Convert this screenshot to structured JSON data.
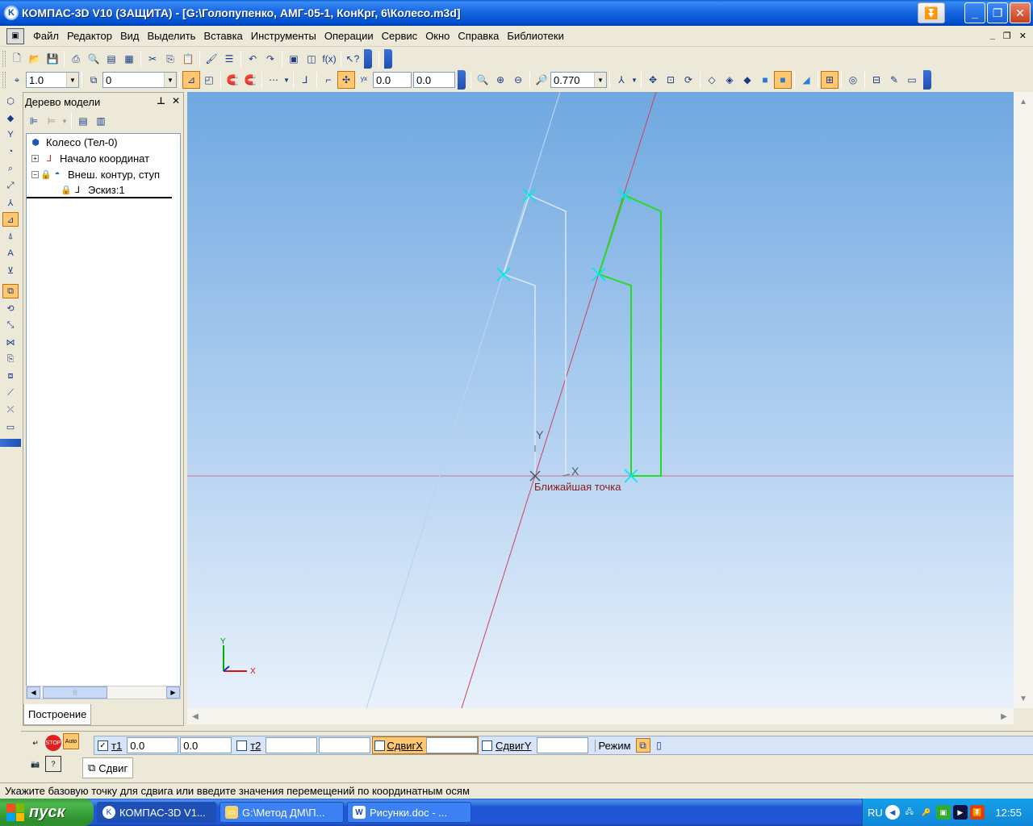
{
  "window": {
    "title": "КОМПАС-3D V10 (ЗАЩИТА) - [G:\\Голопупенко, АМГ-05-1, КонКрг, 6\\Колесо.m3d]",
    "minimize": "_",
    "maximize": "❐",
    "close": "✕"
  },
  "menu": {
    "items": [
      "Файл",
      "Редактор",
      "Вид",
      "Выделить",
      "Вставка",
      "Инструменты",
      "Операции",
      "Сервис",
      "Окно",
      "Справка",
      "Библиотеки"
    ]
  },
  "toolbar2": {
    "step_value": "1.0",
    "layer_value": "0",
    "x_value": "0.0",
    "y_value": "0.0",
    "zoom_value": "0.770"
  },
  "tree": {
    "header": "Дерево модели",
    "root": "Колесо (Тел-0)",
    "items": [
      "Начало координат",
      "Внеш. контур, ступ",
      "Эскиз:1"
    ],
    "tab": "Построение"
  },
  "canvas": {
    "axis_y_label": "Y",
    "axis_x_label": "X",
    "snap_tooltip": "Ближайшая точка",
    "corner_y": "Y",
    "corner_x": "X",
    "colors": {
      "active_contour": "#22dd22",
      "ghost_contour": "#c8d8ee",
      "red_axis": "#d04060",
      "blue_axis": "#a9c8ec",
      "cross_marker": "#00e0e0"
    }
  },
  "propbar": {
    "t1_label": "т1",
    "t1_x": "0.0",
    "t1_y": "0.0",
    "t2_label": "т2",
    "t2_x": "",
    "t2_y": "",
    "shiftx_label": "СдвигX",
    "shiftx_value": "",
    "shifty_label": "СдвигY",
    "shifty_value": "",
    "mode_label": "Режим",
    "tab": "Сдвиг"
  },
  "status": {
    "text": "Укажите базовую точку для сдвига или введите значения перемещений по координатным осям"
  },
  "taskbar": {
    "start": "пуск",
    "tasks": [
      "КОМПАС-3D V1...",
      "G:\\Метод ДМ\\П...",
      "Рисунки.doc - ..."
    ],
    "lang": "RU",
    "clock": "12:55"
  }
}
